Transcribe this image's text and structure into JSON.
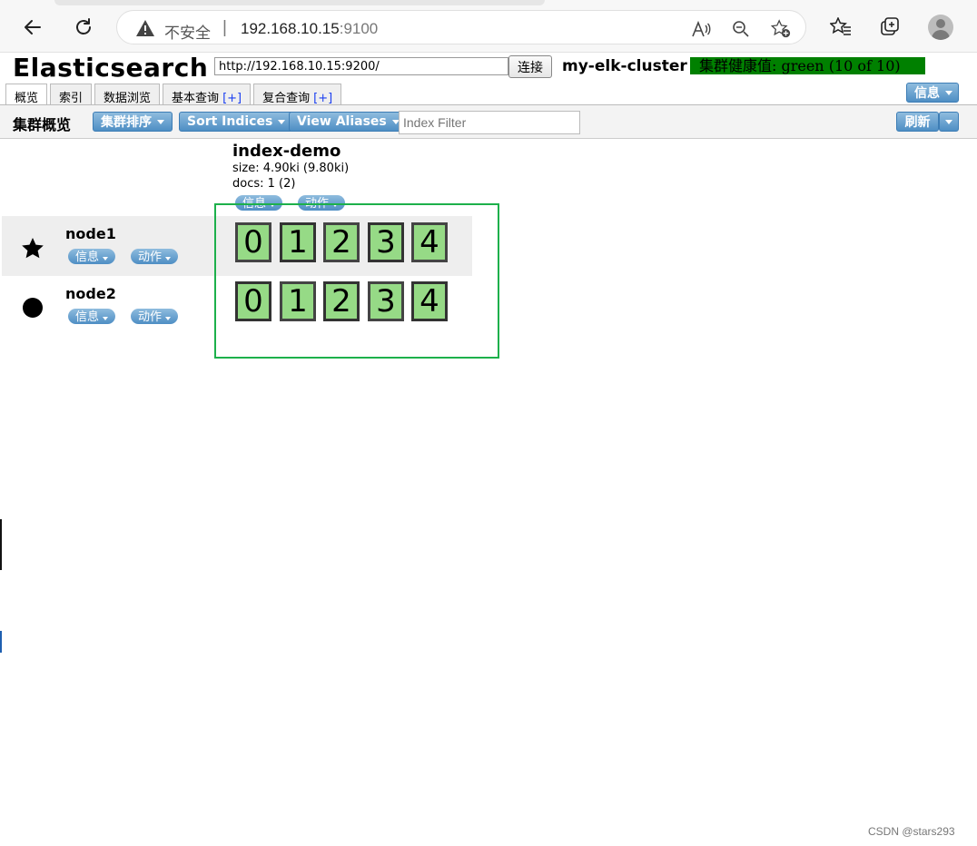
{
  "browser": {
    "insecure_label": "不安全",
    "separator": "|",
    "url_host": "192.168.10.15",
    "url_port": ":9100",
    "icons": [
      "back-icon",
      "reload-icon",
      "warning-icon",
      "read-aloud-icon",
      "zoom-icon",
      "add-favorite-icon",
      "favorites-icon",
      "collections-icon",
      "profile-icon"
    ]
  },
  "header": {
    "app_title": "Elasticsearch",
    "connect_url": "http://192.168.10.15:9200/",
    "connect_label": "连接",
    "cluster_name": "my-elk-cluster",
    "health_text": "集群健康值: green (10 of 10)",
    "health_color": "#008000",
    "info_label": "信息"
  },
  "tabs": [
    {
      "label": "概览",
      "plus": ""
    },
    {
      "label": "索引",
      "plus": ""
    },
    {
      "label": "数据浏览",
      "plus": ""
    },
    {
      "label": "基本查询",
      "plus": "[+]"
    },
    {
      "label": "复合查询",
      "plus": "[+]"
    }
  ],
  "toolbar": {
    "title": "集群概览",
    "sort_cluster_label": "集群排序",
    "sort_indices_label": "Sort Indices",
    "view_aliases_label": "View Aliases",
    "filter_placeholder": "Index Filter",
    "refresh_label": "刷新"
  },
  "index": {
    "name": "index-demo",
    "size": "size: 4.90ki (9.80ki)",
    "docs": "docs: 1 (2)",
    "info_label": "信息",
    "action_label": "动作"
  },
  "nodes": [
    {
      "name": "node1",
      "icon": "star-icon",
      "info_label": "信息",
      "action_label": "动作",
      "shards": [
        "0",
        "1",
        "2",
        "3",
        "4"
      ]
    },
    {
      "name": "node2",
      "icon": "circle-icon",
      "info_label": "信息",
      "action_label": "动作",
      "shards": [
        "0",
        "1",
        "2",
        "3",
        "4"
      ]
    }
  ],
  "shard_color": "#96da86",
  "watermark": "CSDN @stars293"
}
